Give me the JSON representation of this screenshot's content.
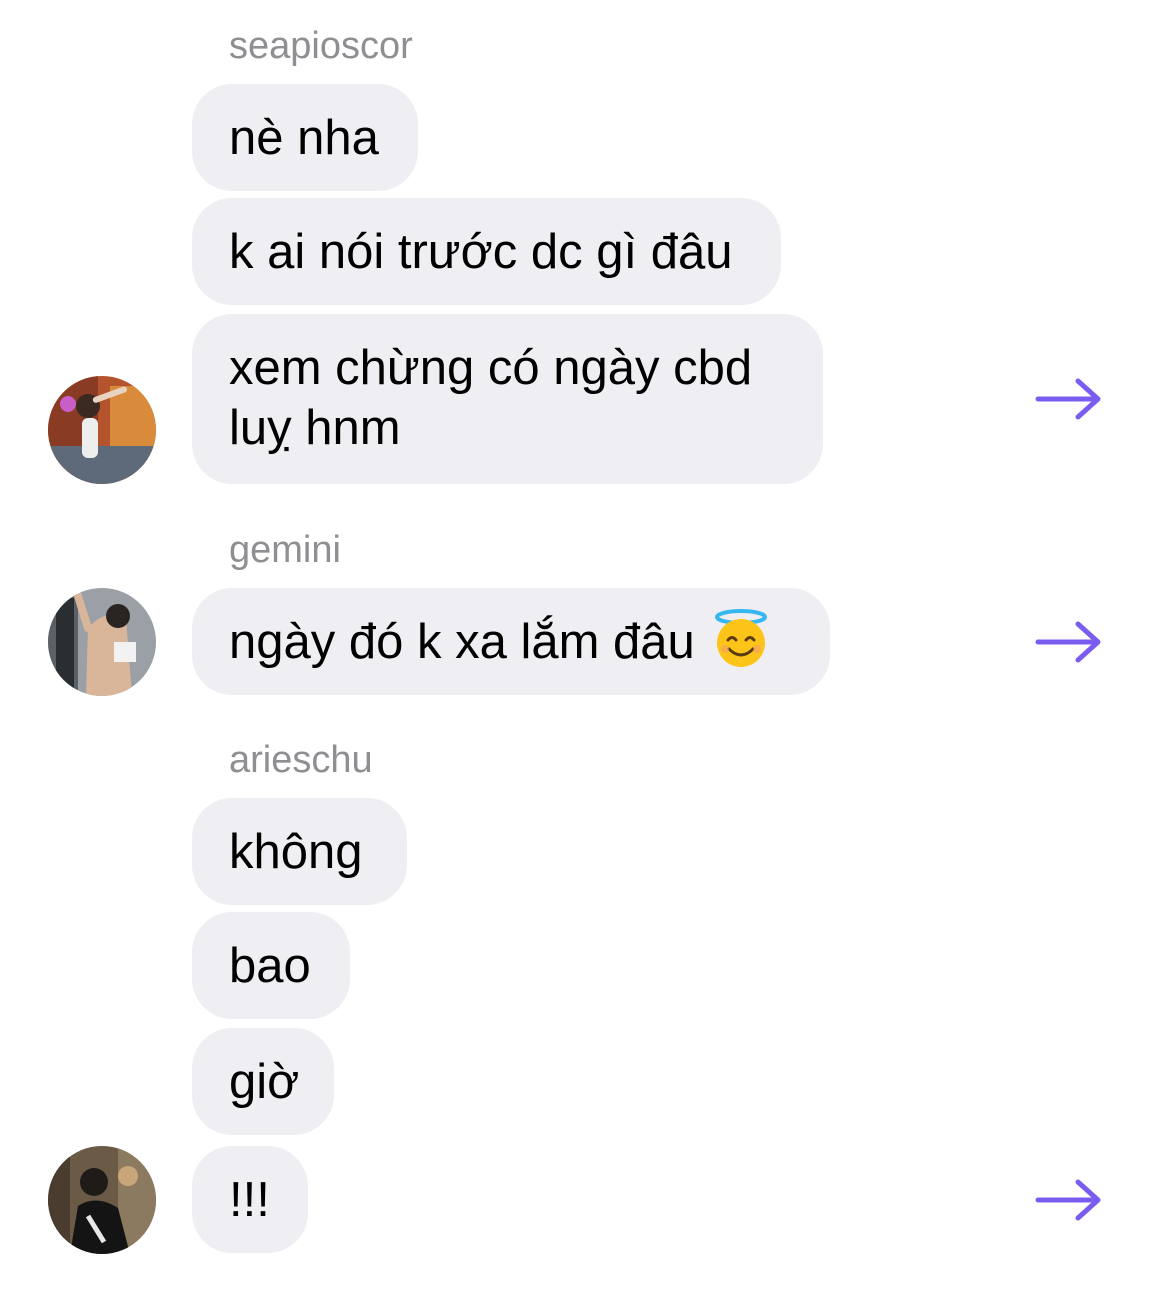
{
  "accent_color": "#7b5cf0",
  "groups": [
    {
      "sender": "seapioscor",
      "messages": [
        "nè nha",
        "k ai nói trước dc gì đâu",
        "xem chừng có ngày cbd luỵ hnm"
      ]
    },
    {
      "sender": "gemini",
      "messages": [
        "ngày đó k xa lắm đâu"
      ],
      "emoji": "smiling-face-with-halo"
    },
    {
      "sender": "arieschu",
      "messages": [
        "không",
        "bao",
        "giờ",
        "!!!"
      ]
    }
  ],
  "icons": {
    "share": "arrow-right-icon"
  }
}
